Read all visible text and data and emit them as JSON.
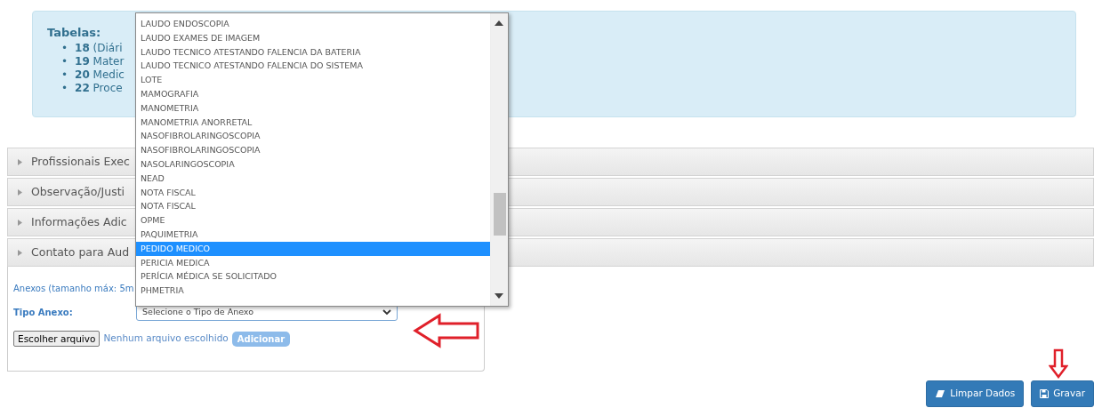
{
  "info": {
    "heading": "Tabelas:",
    "bullet": "•",
    "items": [
      {
        "number": "18",
        "text": "(Diári"
      },
      {
        "number": "19",
        "text": "Mater"
      },
      {
        "number": "20",
        "text": "Medic"
      },
      {
        "number": "22",
        "text": "Proce"
      }
    ]
  },
  "accordion": [
    {
      "label": "Profissionais Exec",
      "expanded": false
    },
    {
      "label": "Observação/Justi",
      "expanded": false
    },
    {
      "label": "Informações Adic",
      "expanded": false
    },
    {
      "label": "Contato para Aud",
      "expanded": false
    }
  ],
  "attachments": {
    "note": "Anexos (tamanho máx: 5m",
    "type_label": "Tipo Anexo:",
    "select_value": "Selecione o Tipo de Anexo",
    "file_button": "Escolher arquivo",
    "file_status": "Nenhum arquivo escolhido",
    "add_button": {
      "label": "Adicionar",
      "disabled": true
    }
  },
  "dropdown": {
    "options": [
      {
        "label": "LAUDO ENDOSCOPIA",
        "selected": false
      },
      {
        "label": "LAUDO EXAMES DE IMAGEM",
        "selected": false
      },
      {
        "label": "LAUDO TECNICO ATESTANDO FALENCIA DA BATERIA",
        "selected": false
      },
      {
        "label": "LAUDO TECNICO ATESTANDO FALENCIA DO SISTEMA",
        "selected": false
      },
      {
        "label": "LOTE",
        "selected": false
      },
      {
        "label": "MAMOGRAFIA",
        "selected": false
      },
      {
        "label": "MANOMETRIA",
        "selected": false
      },
      {
        "label": "MANOMETRIA ANORRETAL",
        "selected": false
      },
      {
        "label": "NASOFIBROLARINGOSCOPIA",
        "selected": false
      },
      {
        "label": "NASOFIBROLARINGOSCOPIA",
        "selected": false
      },
      {
        "label": "NASOLARINGOSCOPIA",
        "selected": false
      },
      {
        "label": "NEAD",
        "selected": false
      },
      {
        "label": "NOTA FISCAL",
        "selected": false
      },
      {
        "label": "NOTA FISCAL",
        "selected": false
      },
      {
        "label": "OPME",
        "selected": false
      },
      {
        "label": "PAQUIMETRIA",
        "selected": false
      },
      {
        "label": "PEDIDO MEDICO",
        "selected": true
      },
      {
        "label": "PERICIA MEDICA",
        "selected": false
      },
      {
        "label": "PERÍCIA MÉDICA SE SOLICITADO",
        "selected": false
      },
      {
        "label": "PHMETRIA",
        "selected": false
      }
    ]
  },
  "buttons": [
    {
      "label": "Limpar Dados",
      "kind": "eraser"
    },
    {
      "label": "Gravar",
      "kind": "save"
    }
  ]
}
